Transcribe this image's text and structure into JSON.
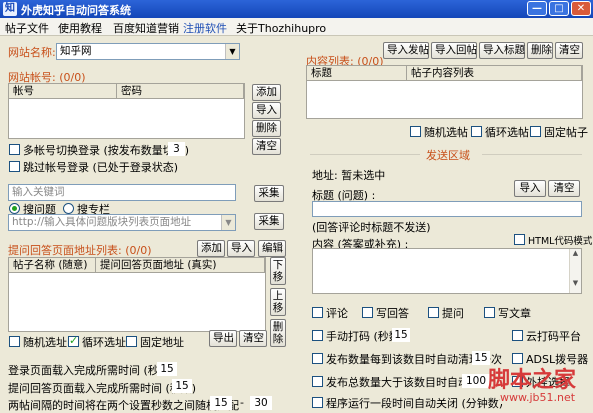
{
  "window": {
    "title": "外虎知乎自动问答系统",
    "icon_label": "知"
  },
  "menu": [
    "帖子文件",
    "使用教程",
    "百度知道营销",
    "注册软件",
    "关于Thozhihupro"
  ],
  "left": {
    "site_name_label": "网站名称:",
    "site_name_value": "知乎网",
    "account_label": "网站帐号: (0/0)",
    "account_columns": [
      "帐号",
      "密码"
    ],
    "account_buttons": [
      "添加",
      "导入",
      "删除",
      "清空"
    ],
    "multi_account_label": "多帐号切换登录 (按发布数量切换)",
    "multi_account_value": "3",
    "skip_login_label": "跳过帐号登录 (已处于登录状态)",
    "keyword_placeholder": "输入关键词",
    "collect_label": "采集",
    "radio_search": "搜问题",
    "radio_column": "搜专栏",
    "url_placeholder": "http://输入具体问题版块列表页面地址",
    "collect2_label": "采集",
    "list_label": "提问回答页面地址列表: (0/0)",
    "list_buttons": [
      "添加",
      "导入",
      "编辑"
    ],
    "list_columns": [
      "帖子名称 (随意)",
      "提问回答页面地址 (真实)"
    ],
    "move_down": "下移",
    "move_up": "上移",
    "delete_btn": "删除",
    "random_site": "随机选址",
    "loop_site": "循环选址",
    "fixed_site": "固定地址",
    "export_btn": "导出",
    "clear_btn": "清空",
    "login_wait_label": "登录页面载入完成所需时间 (秒数)",
    "login_wait_value": "15",
    "answer_wait_label": "提问回答页面载入完成所需时间 (秒数)",
    "answer_wait_value": "15",
    "interval_label": "两帖间隔的时间将在两个设置秒数之间随机分配",
    "interval_from": "15",
    "interval_sep": "-",
    "interval_to": "30"
  },
  "right": {
    "top_buttons": [
      "导入发帖",
      "导入回帖",
      "导入标题",
      "删除",
      "清空"
    ],
    "content_list_label": "内容列表: (0/0)",
    "content_columns": [
      "标题",
      "帖子内容列表"
    ],
    "random_post": "随机选帖",
    "loop_post": "循环选帖",
    "fixed_post": "固定帖子",
    "send_area_label": "发送区域",
    "address_label": "地址: 暂未选中",
    "title_label": "标题 (问题) :",
    "import_btn": "导入",
    "clear_btn": "清空",
    "title_note": "(回答评论时标题不发送)",
    "content_label": "内容 (答案或补充) :",
    "html_mode": "HTML代码模式",
    "opt_comment": "评论",
    "opt_answer": "写回答",
    "opt_question": "提问",
    "opt_article": "写文章",
    "manual_captcha": "手动打码 (秒数)",
    "manual_captcha_value": "15",
    "cloud_captcha": "云打码平台",
    "clear_daily_label": "发布数量每到该数目时自动清理一次",
    "clear_daily_value": "15",
    "adsl_dial": "ADSL拨号器",
    "auto_stop_label": "发布总数量大于该数目时自动停止",
    "auto_stop_value": "100",
    "plugin_label": "外挂选择",
    "auto_close_label": "程序运行一段时间自动关闭 (分钟数)"
  },
  "watermark": {
    "main": "脚本之家",
    "url": "www.jb51.net"
  }
}
